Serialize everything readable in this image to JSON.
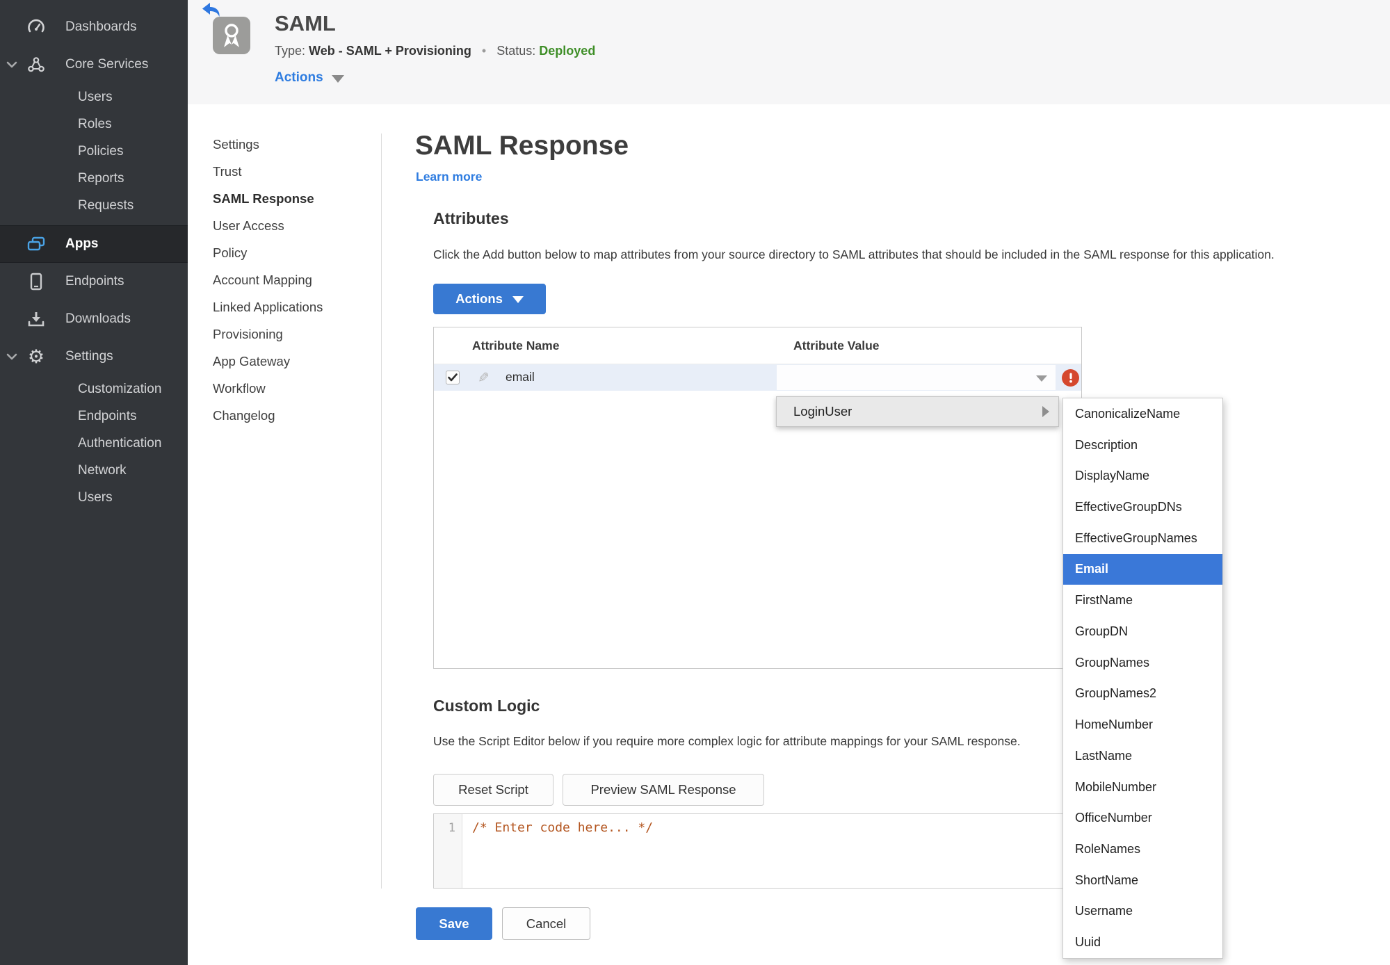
{
  "sidebar": {
    "items": [
      {
        "label": "Dashboards",
        "icon": "gauge-icon"
      },
      {
        "label": "Core Services",
        "icon": "core-services-icon",
        "expanded": true
      },
      {
        "label": "Users"
      },
      {
        "label": "Roles"
      },
      {
        "label": "Policies"
      },
      {
        "label": "Reports"
      },
      {
        "label": "Requests"
      },
      {
        "label": "Apps",
        "icon": "apps-icon",
        "active": true
      },
      {
        "label": "Endpoints",
        "icon": "endpoint-icon"
      },
      {
        "label": "Downloads",
        "icon": "download-icon"
      },
      {
        "label": "Settings",
        "icon": "gear-icon",
        "expanded": true
      },
      {
        "label": "Customization"
      },
      {
        "label": "Endpoints"
      },
      {
        "label": "Authentication"
      },
      {
        "label": "Network"
      },
      {
        "label": "Users"
      }
    ]
  },
  "header": {
    "title": "SAML",
    "type_label": "Type:",
    "type_value": "Web - SAML + Provisioning",
    "separator": "•",
    "status_label": "Status:",
    "status_value": "Deployed",
    "actions_label": "Actions"
  },
  "nav": {
    "items": [
      {
        "label": "Settings"
      },
      {
        "label": "Trust"
      },
      {
        "label": "SAML Response",
        "active": true
      },
      {
        "label": "User Access"
      },
      {
        "label": "Policy"
      },
      {
        "label": "Account Mapping"
      },
      {
        "label": "Linked Applications"
      },
      {
        "label": "Provisioning"
      },
      {
        "label": "App Gateway"
      },
      {
        "label": "Workflow"
      },
      {
        "label": "Changelog"
      }
    ]
  },
  "main": {
    "title": "SAML Response",
    "learn_more": "Learn more",
    "attributes": {
      "heading": "Attributes",
      "description": "Click the Add button below to map attributes from your source directory to SAML attributes that should be included in the SAML response for this application.",
      "actions_button": "Actions",
      "table": {
        "columns": [
          "Attribute Name",
          "Attribute Value"
        ],
        "row": {
          "name": "email",
          "value": "",
          "checked": true,
          "error": true
        }
      }
    },
    "custom_logic": {
      "heading": "Custom Logic",
      "description": "Use the Script Editor below if you require more complex logic for attribute mappings for your SAML response.",
      "reset_button": "Reset Script",
      "preview_button": "Preview SAML Response",
      "editor": {
        "line_number": "1",
        "code": "/* Enter code here... */"
      }
    },
    "footer": {
      "save": "Save",
      "cancel": "Cancel"
    }
  },
  "menu": {
    "parent": "LoginUser",
    "selected": "Email",
    "items": [
      "CanonicalizeName",
      "Description",
      "DisplayName",
      "EffectiveGroupDNs",
      "EffectiveGroupNames",
      "Email",
      "FirstName",
      "GroupDN",
      "GroupNames",
      "GroupNames2",
      "HomeNumber",
      "LastName",
      "MobileNumber",
      "OfficeNumber",
      "RoleNames",
      "ShortName",
      "Username",
      "Uuid"
    ]
  },
  "colors": {
    "accent_blue": "#3879d2",
    "link_blue": "#2e7ce0",
    "status_green": "#3e8e27",
    "error_red": "#d5482e",
    "sidebar_bg": "#33363a",
    "selected_row": "#e8eef8",
    "selected_menu_item": "#3a78d8"
  },
  "icons": {
    "back": "back-arrow-icon",
    "app": "award-ribbon-icon",
    "row_edit": "pencil-icon",
    "row_error": "error-exclamation-icon",
    "dropdowns": [
      "chevron-down-icon",
      "triangle-down-icon",
      "triangle-right-icon"
    ]
  }
}
